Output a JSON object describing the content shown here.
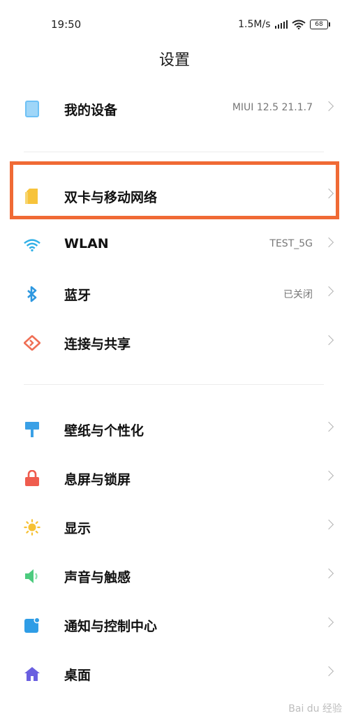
{
  "status_bar": {
    "time": "19:50",
    "network_speed": "1.5M/s",
    "battery_level": "68"
  },
  "header": {
    "title": "设置"
  },
  "settings": [
    {
      "id": "my-device",
      "label": "我的设备",
      "value": "MIUI 12.5 21.1.7",
      "icon": "tablet-icon",
      "color": "#6ec1f5"
    },
    {
      "id": "sim-mobile-network",
      "label": "双卡与移动网络",
      "value": "",
      "icon": "sim-card-icon",
      "color": "#f7c33b",
      "highlighted": true
    },
    {
      "id": "wlan",
      "label": "WLAN",
      "value": "TEST_5G",
      "icon": "wifi-icon",
      "color": "#31b0e7"
    },
    {
      "id": "bluetooth",
      "label": "蓝牙",
      "value": "已关闭",
      "icon": "bluetooth-icon",
      "color": "#2e98e0"
    },
    {
      "id": "connection-sharing",
      "label": "连接与共享",
      "value": "",
      "icon": "share-diamond-icon",
      "color": "#ef6f55"
    },
    {
      "id": "wallpaper",
      "label": "壁纸与个性化",
      "value": "",
      "icon": "brush-icon",
      "color": "#3aa0e6"
    },
    {
      "id": "lock-screen",
      "label": "息屏与锁屏",
      "value": "",
      "icon": "lock-icon",
      "color": "#ef5c4e"
    },
    {
      "id": "display",
      "label": "显示",
      "value": "",
      "icon": "sun-icon",
      "color": "#f6c135"
    },
    {
      "id": "sound",
      "label": "声音与触感",
      "value": "",
      "icon": "speaker-icon",
      "color": "#4ccb7e"
    },
    {
      "id": "notifications",
      "label": "通知与控制中心",
      "value": "",
      "icon": "notification-icon",
      "color": "#2f9de6"
    },
    {
      "id": "home-screen",
      "label": "桌面",
      "value": "",
      "icon": "home-icon",
      "color": "#6a5fe0"
    }
  ],
  "watermark": "Bai du 经验"
}
